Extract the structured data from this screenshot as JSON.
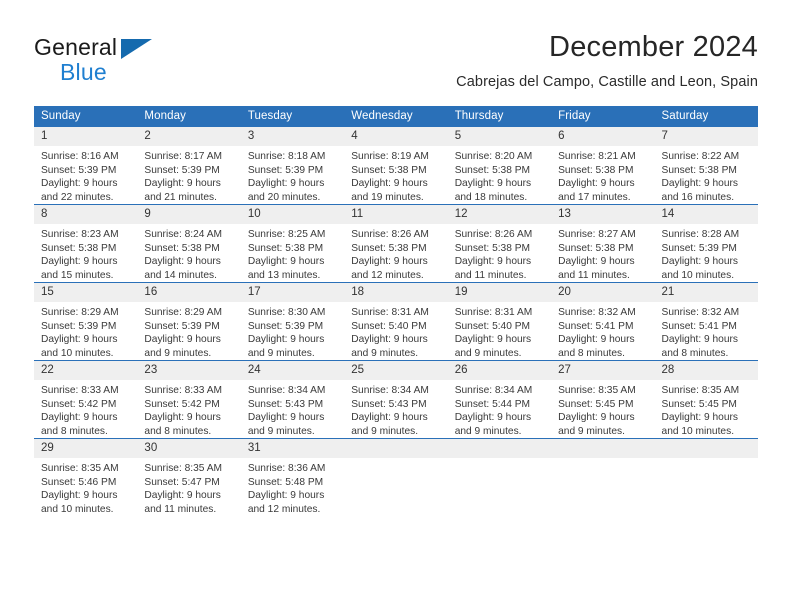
{
  "brand": {
    "name_top": "General",
    "name_bottom": "Blue",
    "mark": "triangle-logo",
    "color_dark": "#1a1a1a",
    "color_blue": "#1f7fd0"
  },
  "header": {
    "title": "December 2024",
    "subtitle": "Cabrejas del Campo, Castille and Leon, Spain"
  },
  "theme": {
    "header_blue": "#2a70b8",
    "daynum_gray": "#efefef",
    "text": "#333333"
  },
  "weekdays": [
    "Sunday",
    "Monday",
    "Tuesday",
    "Wednesday",
    "Thursday",
    "Friday",
    "Saturday"
  ],
  "weeks": [
    [
      {
        "day": "1",
        "sunrise": "Sunrise: 8:16 AM",
        "sunset": "Sunset: 5:39 PM",
        "daylight_1": "Daylight: 9 hours",
        "daylight_2": "and 22 minutes."
      },
      {
        "day": "2",
        "sunrise": "Sunrise: 8:17 AM",
        "sunset": "Sunset: 5:39 PM",
        "daylight_1": "Daylight: 9 hours",
        "daylight_2": "and 21 minutes."
      },
      {
        "day": "3",
        "sunrise": "Sunrise: 8:18 AM",
        "sunset": "Sunset: 5:39 PM",
        "daylight_1": "Daylight: 9 hours",
        "daylight_2": "and 20 minutes."
      },
      {
        "day": "4",
        "sunrise": "Sunrise: 8:19 AM",
        "sunset": "Sunset: 5:38 PM",
        "daylight_1": "Daylight: 9 hours",
        "daylight_2": "and 19 minutes."
      },
      {
        "day": "5",
        "sunrise": "Sunrise: 8:20 AM",
        "sunset": "Sunset: 5:38 PM",
        "daylight_1": "Daylight: 9 hours",
        "daylight_2": "and 18 minutes."
      },
      {
        "day": "6",
        "sunrise": "Sunrise: 8:21 AM",
        "sunset": "Sunset: 5:38 PM",
        "daylight_1": "Daylight: 9 hours",
        "daylight_2": "and 17 minutes."
      },
      {
        "day": "7",
        "sunrise": "Sunrise: 8:22 AM",
        "sunset": "Sunset: 5:38 PM",
        "daylight_1": "Daylight: 9 hours",
        "daylight_2": "and 16 minutes."
      }
    ],
    [
      {
        "day": "8",
        "sunrise": "Sunrise: 8:23 AM",
        "sunset": "Sunset: 5:38 PM",
        "daylight_1": "Daylight: 9 hours",
        "daylight_2": "and 15 minutes."
      },
      {
        "day": "9",
        "sunrise": "Sunrise: 8:24 AM",
        "sunset": "Sunset: 5:38 PM",
        "daylight_1": "Daylight: 9 hours",
        "daylight_2": "and 14 minutes."
      },
      {
        "day": "10",
        "sunrise": "Sunrise: 8:25 AM",
        "sunset": "Sunset: 5:38 PM",
        "daylight_1": "Daylight: 9 hours",
        "daylight_2": "and 13 minutes."
      },
      {
        "day": "11",
        "sunrise": "Sunrise: 8:26 AM",
        "sunset": "Sunset: 5:38 PM",
        "daylight_1": "Daylight: 9 hours",
        "daylight_2": "and 12 minutes."
      },
      {
        "day": "12",
        "sunrise": "Sunrise: 8:26 AM",
        "sunset": "Sunset: 5:38 PM",
        "daylight_1": "Daylight: 9 hours",
        "daylight_2": "and 11 minutes."
      },
      {
        "day": "13",
        "sunrise": "Sunrise: 8:27 AM",
        "sunset": "Sunset: 5:38 PM",
        "daylight_1": "Daylight: 9 hours",
        "daylight_2": "and 11 minutes."
      },
      {
        "day": "14",
        "sunrise": "Sunrise: 8:28 AM",
        "sunset": "Sunset: 5:39 PM",
        "daylight_1": "Daylight: 9 hours",
        "daylight_2": "and 10 minutes."
      }
    ],
    [
      {
        "day": "15",
        "sunrise": "Sunrise: 8:29 AM",
        "sunset": "Sunset: 5:39 PM",
        "daylight_1": "Daylight: 9 hours",
        "daylight_2": "and 10 minutes."
      },
      {
        "day": "16",
        "sunrise": "Sunrise: 8:29 AM",
        "sunset": "Sunset: 5:39 PM",
        "daylight_1": "Daylight: 9 hours",
        "daylight_2": "and 9 minutes."
      },
      {
        "day": "17",
        "sunrise": "Sunrise: 8:30 AM",
        "sunset": "Sunset: 5:39 PM",
        "daylight_1": "Daylight: 9 hours",
        "daylight_2": "and 9 minutes."
      },
      {
        "day": "18",
        "sunrise": "Sunrise: 8:31 AM",
        "sunset": "Sunset: 5:40 PM",
        "daylight_1": "Daylight: 9 hours",
        "daylight_2": "and 9 minutes."
      },
      {
        "day": "19",
        "sunrise": "Sunrise: 8:31 AM",
        "sunset": "Sunset: 5:40 PM",
        "daylight_1": "Daylight: 9 hours",
        "daylight_2": "and 9 minutes."
      },
      {
        "day": "20",
        "sunrise": "Sunrise: 8:32 AM",
        "sunset": "Sunset: 5:41 PM",
        "daylight_1": "Daylight: 9 hours",
        "daylight_2": "and 8 minutes."
      },
      {
        "day": "21",
        "sunrise": "Sunrise: 8:32 AM",
        "sunset": "Sunset: 5:41 PM",
        "daylight_1": "Daylight: 9 hours",
        "daylight_2": "and 8 minutes."
      }
    ],
    [
      {
        "day": "22",
        "sunrise": "Sunrise: 8:33 AM",
        "sunset": "Sunset: 5:42 PM",
        "daylight_1": "Daylight: 9 hours",
        "daylight_2": "and 8 minutes."
      },
      {
        "day": "23",
        "sunrise": "Sunrise: 8:33 AM",
        "sunset": "Sunset: 5:42 PM",
        "daylight_1": "Daylight: 9 hours",
        "daylight_2": "and 8 minutes."
      },
      {
        "day": "24",
        "sunrise": "Sunrise: 8:34 AM",
        "sunset": "Sunset: 5:43 PM",
        "daylight_1": "Daylight: 9 hours",
        "daylight_2": "and 9 minutes."
      },
      {
        "day": "25",
        "sunrise": "Sunrise: 8:34 AM",
        "sunset": "Sunset: 5:43 PM",
        "daylight_1": "Daylight: 9 hours",
        "daylight_2": "and 9 minutes."
      },
      {
        "day": "26",
        "sunrise": "Sunrise: 8:34 AM",
        "sunset": "Sunset: 5:44 PM",
        "daylight_1": "Daylight: 9 hours",
        "daylight_2": "and 9 minutes."
      },
      {
        "day": "27",
        "sunrise": "Sunrise: 8:35 AM",
        "sunset": "Sunset: 5:45 PM",
        "daylight_1": "Daylight: 9 hours",
        "daylight_2": "and 9 minutes."
      },
      {
        "day": "28",
        "sunrise": "Sunrise: 8:35 AM",
        "sunset": "Sunset: 5:45 PM",
        "daylight_1": "Daylight: 9 hours",
        "daylight_2": "and 10 minutes."
      }
    ],
    [
      {
        "day": "29",
        "sunrise": "Sunrise: 8:35 AM",
        "sunset": "Sunset: 5:46 PM",
        "daylight_1": "Daylight: 9 hours",
        "daylight_2": "and 10 minutes."
      },
      {
        "day": "30",
        "sunrise": "Sunrise: 8:35 AM",
        "sunset": "Sunset: 5:47 PM",
        "daylight_1": "Daylight: 9 hours",
        "daylight_2": "and 11 minutes."
      },
      {
        "day": "31",
        "sunrise": "Sunrise: 8:36 AM",
        "sunset": "Sunset: 5:48 PM",
        "daylight_1": "Daylight: 9 hours",
        "daylight_2": "and 12 minutes."
      },
      {
        "day": "",
        "sunrise": "",
        "sunset": "",
        "daylight_1": "",
        "daylight_2": ""
      },
      {
        "day": "",
        "sunrise": "",
        "sunset": "",
        "daylight_1": "",
        "daylight_2": ""
      },
      {
        "day": "",
        "sunrise": "",
        "sunset": "",
        "daylight_1": "",
        "daylight_2": ""
      },
      {
        "day": "",
        "sunrise": "",
        "sunset": "",
        "daylight_1": "",
        "daylight_2": ""
      }
    ]
  ]
}
